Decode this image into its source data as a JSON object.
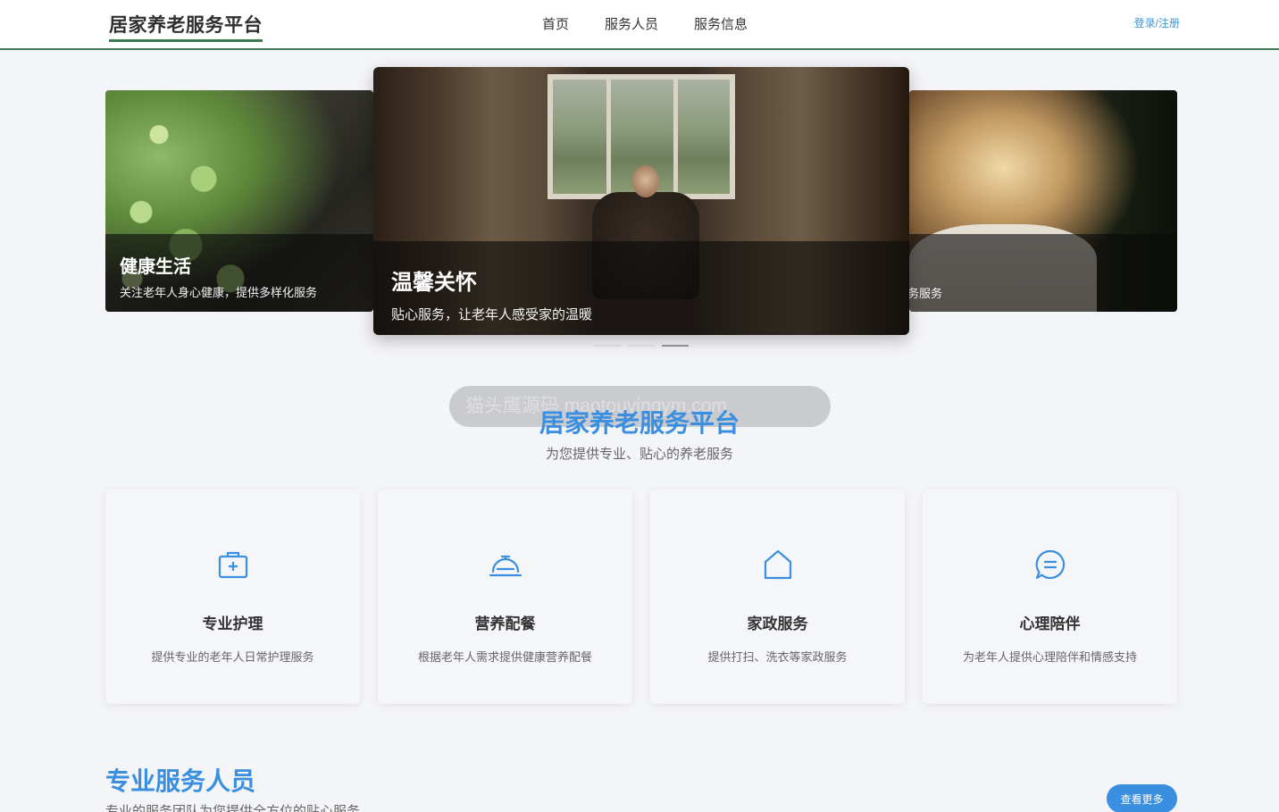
{
  "header": {
    "brand": "居家养老服务平台",
    "nav": [
      "首页",
      "服务人员",
      "服务信息"
    ],
    "login": "登录/注册"
  },
  "carousel": {
    "slides": [
      {
        "title": "健康生活",
        "desc": "关注老年人身心健康，提供多样化服务"
      },
      {
        "title": "温馨关怀",
        "desc": "贴心服务，让老年人感受家的温暖"
      },
      {
        "title": "",
        "desc": "务服务"
      }
    ],
    "active_index": 2
  },
  "watermark": "猫头鹰源码 maotouyingym.com",
  "intro": {
    "title": "居家养老服务平台",
    "subtitle": "为您提供专业、贴心的养老服务"
  },
  "services": [
    {
      "icon": "medical-kit-icon",
      "title": "专业护理",
      "desc": "提供专业的老年人日常护理服务"
    },
    {
      "icon": "food-cloche-icon",
      "title": "营养配餐",
      "desc": "根据老年人需求提供健康营养配餐"
    },
    {
      "icon": "house-icon",
      "title": "家政服务",
      "desc": "提供打扫、洗衣等家政服务"
    },
    {
      "icon": "chat-icon",
      "title": "心理陪伴",
      "desc": "为老年人提供心理陪伴和情感支持"
    }
  ],
  "staff": {
    "title": "专业服务人员",
    "subtitle": "专业的服务团队为您提供全方位的贴心服务",
    "more": "查看更多"
  },
  "colors": {
    "accent": "#3b8fe0",
    "brand_underline": "#3f7a57",
    "background": "#f4f5f8"
  }
}
